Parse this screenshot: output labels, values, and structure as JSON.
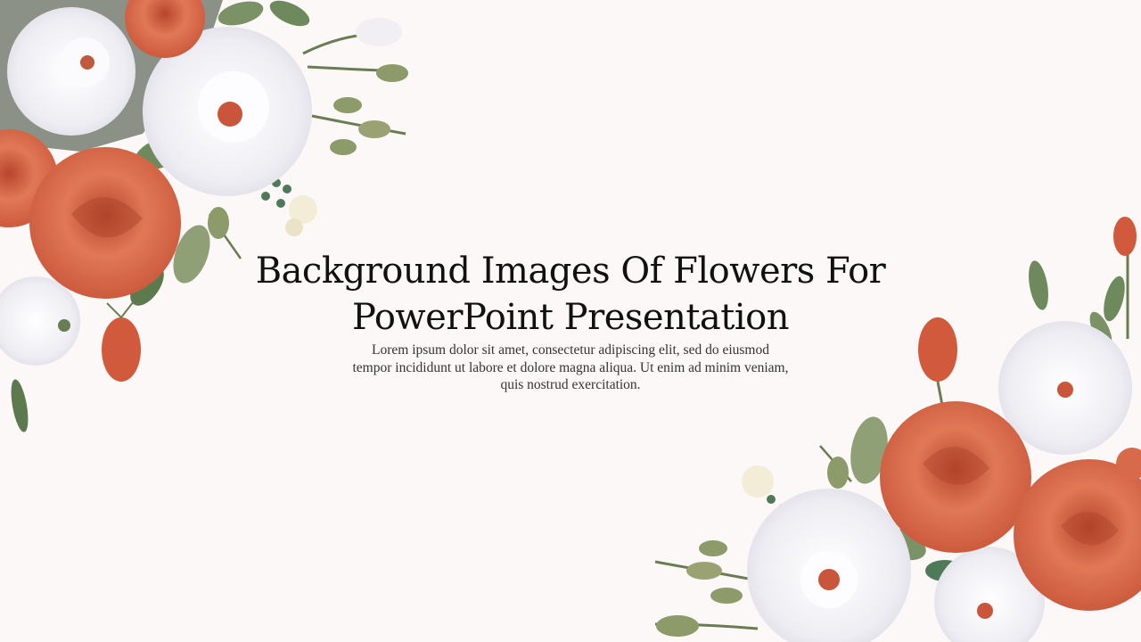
{
  "slide": {
    "title": "Background Images Of Flowers For PowerPoint Presentation",
    "body": "Lorem ipsum dolor sit amet, consectetur adipiscing elit, sed do eiusmod tempor incididunt ut labore et dolore magna aliqua. Ut enim ad minim veniam, quis nostrud exercitation."
  },
  "decorations": {
    "top_left": "floral-corner-bouquet-icon",
    "bottom_right": "floral-corner-bouquet-icon"
  },
  "colors": {
    "background": "#fcf8f7",
    "rose": "#d9603f",
    "white_rose": "#f4f2f6",
    "leaf": "#5f7a4f"
  }
}
